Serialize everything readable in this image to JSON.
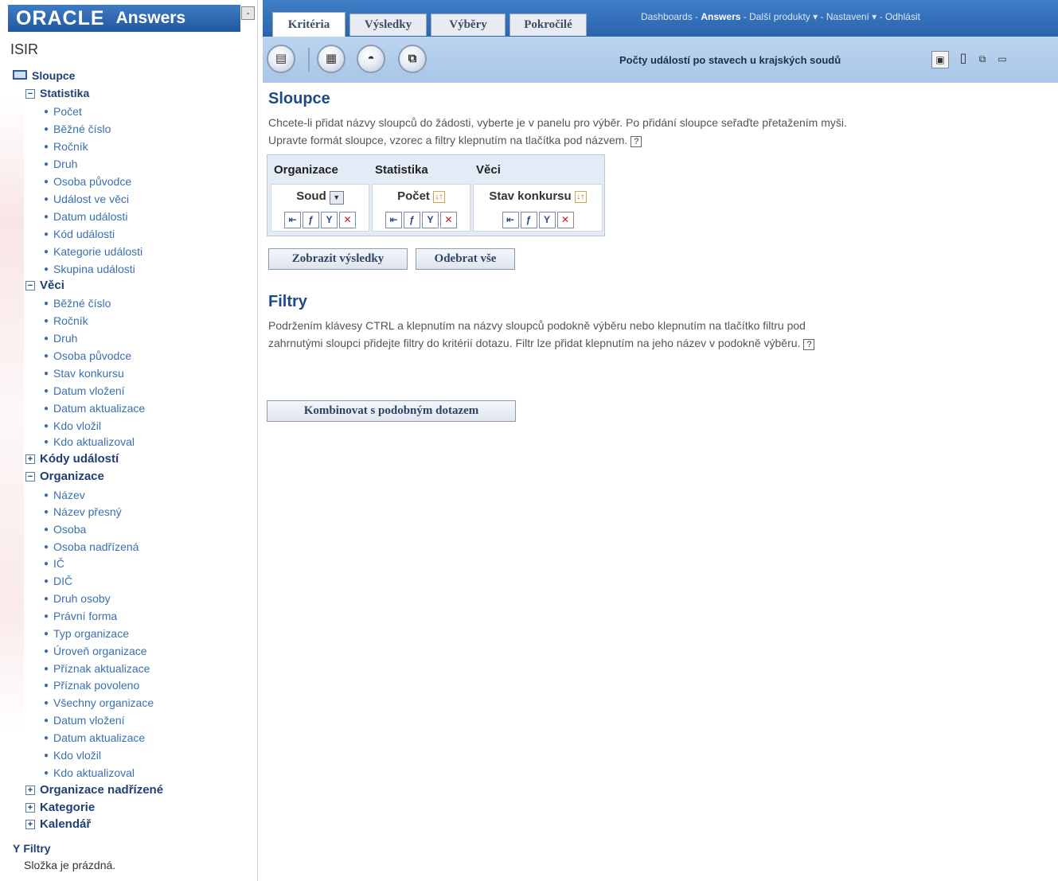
{
  "header": {
    "logo": "ORACLE",
    "app": "Answers",
    "collapse": "-",
    "subject_area": "ISIR"
  },
  "tree": {
    "root": "Sloupce",
    "statistika": {
      "label": "Statistika",
      "items": [
        "Počet",
        "Běžné číslo",
        "Ročník",
        "Druh",
        "Osoba původce",
        "Událost ve věci",
        "Datum události",
        "Kód události",
        "Kategorie události",
        "Skupina události"
      ]
    },
    "veci": {
      "label": "Věci",
      "items": [
        "Běžné číslo",
        "Ročník",
        "Druh",
        "Osoba původce",
        "Stav konkursu",
        "Datum vložení",
        "Datum aktualizace",
        "Kdo vložil",
        "Kdo aktualizoval"
      ]
    },
    "kody": {
      "label": "Kódy událostí"
    },
    "organizace": {
      "label": "Organizace",
      "items": [
        "Název",
        "Název přesný",
        "Osoba",
        "Osoba nadřízená",
        "IČ",
        "DIČ",
        "Druh osoby",
        "Právní forma",
        "Typ organizace",
        "Úroveň organizace",
        "Příznak aktualizace",
        "Příznak povoleno",
        "Všechny organizace",
        "Datum vložení",
        "Datum aktualizace",
        "Kdo vložil",
        "Kdo aktualizoval"
      ]
    },
    "org_nadrizene": {
      "label": "Organizace nadřízené"
    },
    "kategorie": {
      "label": "Kategorie"
    },
    "kalendar": {
      "label": "Kalendář"
    },
    "filtry": {
      "label": "Filtry",
      "empty": "Složka je prázdná."
    }
  },
  "tabs": [
    "Kritéria",
    "Výsledky",
    "Výběry",
    "Pokročilé"
  ],
  "global_nav": {
    "dashboards": "Dashboards",
    "answers": "Answers",
    "more": "Další produkty",
    "settings": "Nastavení",
    "logout": "Odhlásit",
    "sep": " - ",
    "drop": " ▾ "
  },
  "toolbar": {
    "report_title": "Počty událostí po stavech u krajských soudů"
  },
  "columns_section": {
    "title": "Sloupce",
    "line1": "Chcete-li přidat názvy sloupců do žádosti, vyberte je v panelu pro výběr. Po přidání sloupce seřaďte přetažením myši.",
    "line2": "Upravte formát sloupce, vzorec a filtry klepnutím na tlačítka pod názvem.",
    "table": {
      "headers": [
        "Organizace",
        "Statistika",
        "Věci"
      ],
      "columns": [
        "Soud",
        "Počet",
        "Stav konkursu"
      ]
    },
    "show_results": "Zobrazit výsledky",
    "remove_all": "Odebrat vše"
  },
  "filters_section": {
    "title": "Filtry",
    "line1": "Podržením klávesy CTRL a klepnutím na názvy sloupců podokně výběru nebo klepnutím na tlačítko filtru pod",
    "line2": "zahrnutými sloupci přidejte filtry do kritérií dotazu. Filtr lze přidat klepnutím na jeho název v podokně výběru."
  },
  "combine_button": "Kombinovat s podobným dotazem",
  "colors": {
    "brand_blue": "#2a64ad",
    "toolbar": "#a9c6e8",
    "section_title": "#1f4a86",
    "tree_folder": "#1f3f73",
    "tree_leaf": "#3a6fb0"
  }
}
